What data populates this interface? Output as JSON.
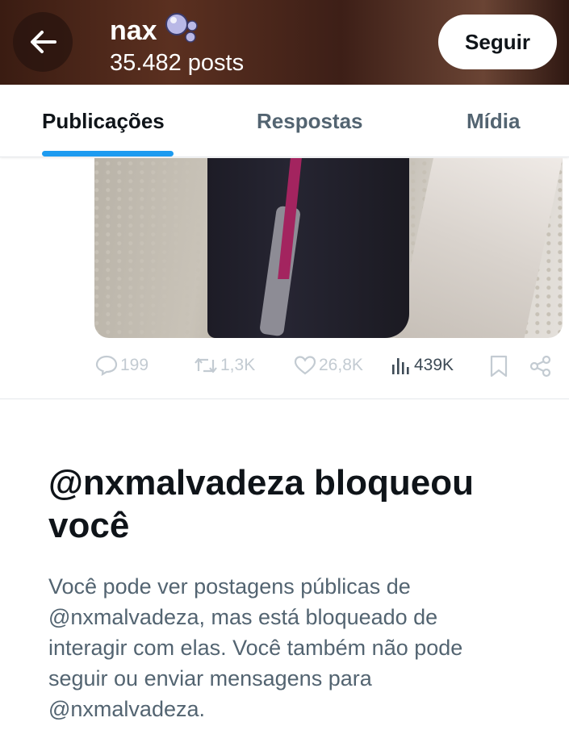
{
  "header": {
    "back_icon": "arrow-left-icon",
    "name": "nax",
    "name_emoji_icon": "bubbles-icon",
    "posts_count": "35.482 posts",
    "follow_label": "Seguir"
  },
  "tabs": [
    {
      "label": "Publicações",
      "active": true
    },
    {
      "label": "Respostas",
      "active": false
    },
    {
      "label": "Mídia",
      "active": false
    }
  ],
  "post_actions": {
    "replies": "199",
    "reposts": "1,3K",
    "likes": "26,8K",
    "views": "439K"
  },
  "blocked_notice": {
    "title": "@nxmalvadeza bloqueou você",
    "body": "Você pode ver postagens públicas de @nxmalvadeza, mas está bloqueado de interagir com elas. Você também não pode seguir ou enviar mensagens para @nxmalvadeza."
  },
  "colors": {
    "accent": "#1d9bf0",
    "text_primary": "#0f1419",
    "text_secondary": "#536471"
  }
}
